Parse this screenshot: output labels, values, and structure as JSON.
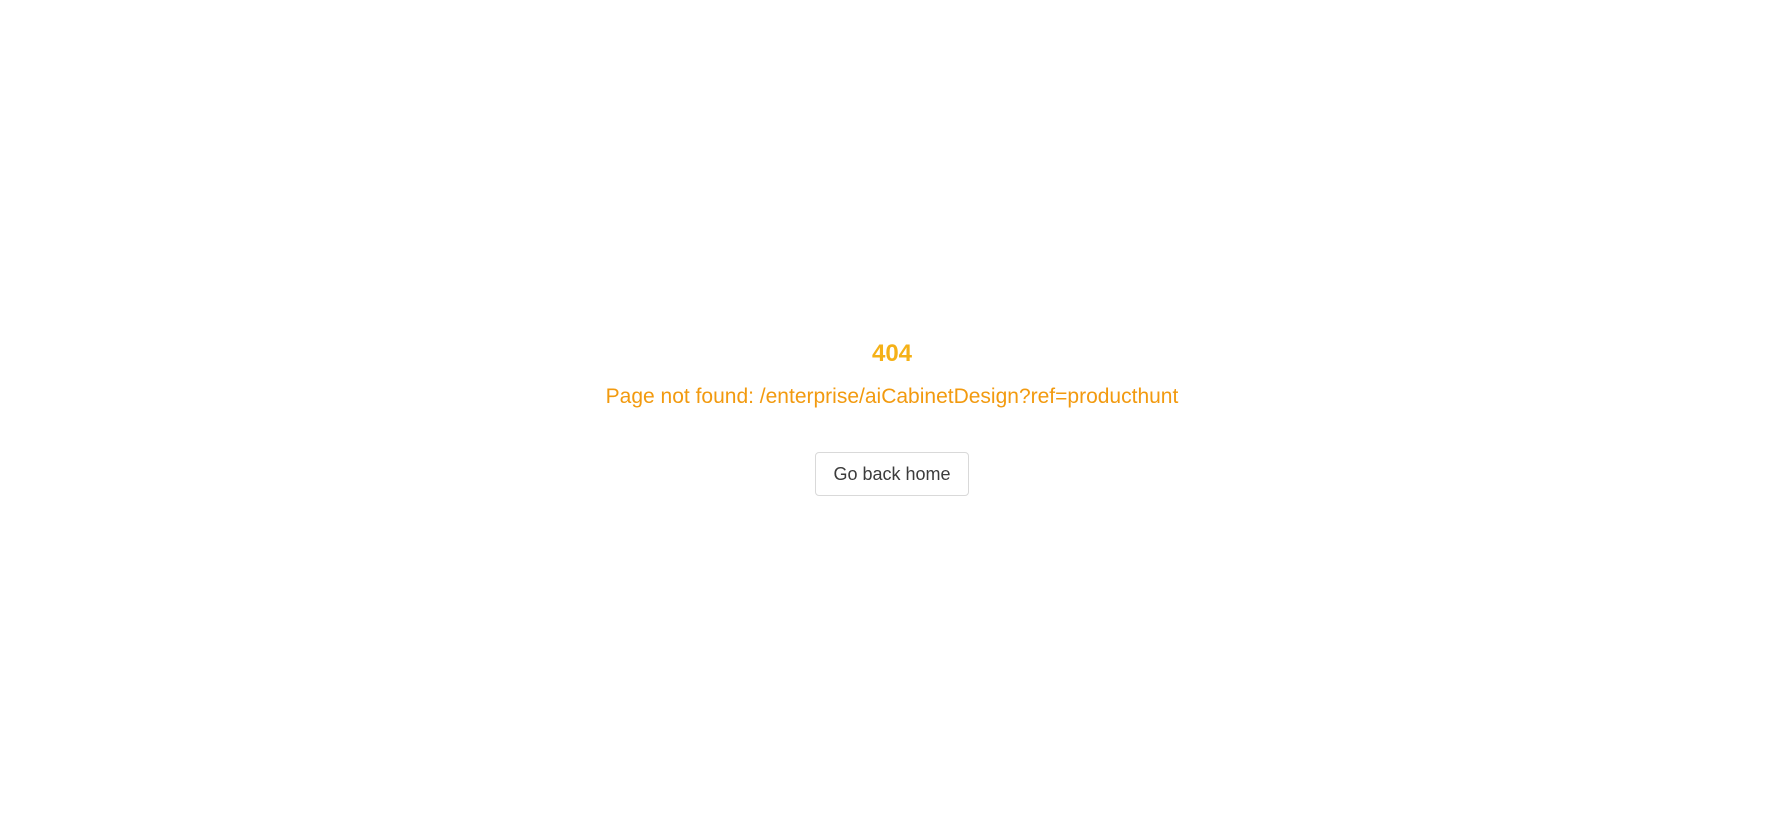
{
  "error": {
    "code": "404",
    "message": "Page not found: /enterprise/aiCabinetDesign?ref=producthunt",
    "home_button_label": "Go back home"
  },
  "colors": {
    "code": "#f5b117",
    "message": "#f29a0f",
    "button_text": "#3c3c3c",
    "button_border": "#d9d9d9"
  }
}
